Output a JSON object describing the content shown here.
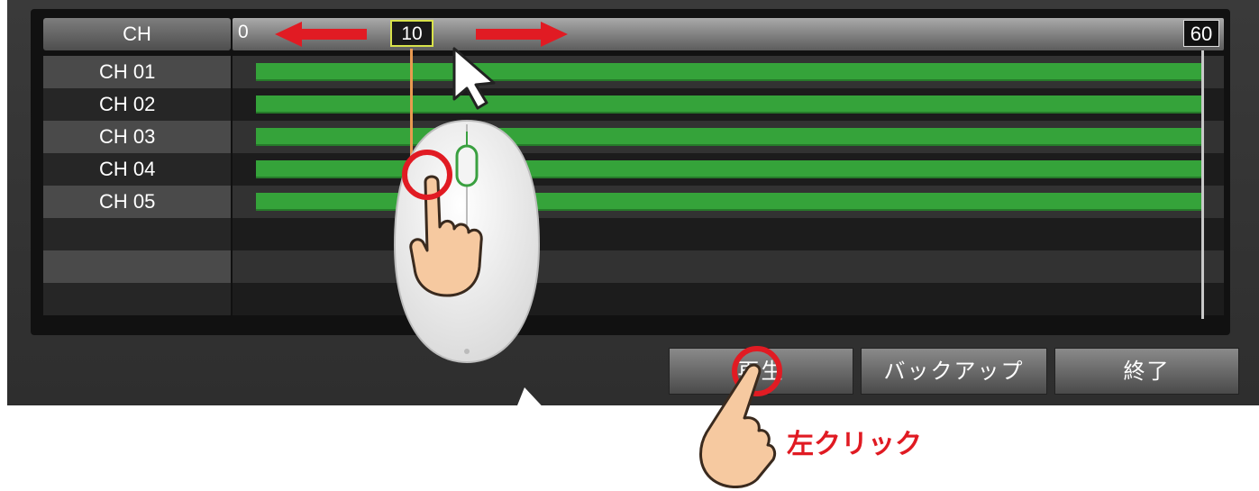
{
  "header": {
    "channel_column_label": "CH",
    "scale_start": "0",
    "scale_cursor": "10",
    "scale_end": "60"
  },
  "channels": [
    {
      "label": "CH 01"
    },
    {
      "label": "CH 02"
    },
    {
      "label": "CH 03"
    },
    {
      "label": "CH 04"
    },
    {
      "label": "CH 05"
    },
    {
      "label": ""
    },
    {
      "label": ""
    },
    {
      "label": ""
    }
  ],
  "buttons": {
    "play": "再生",
    "backup": "バックアップ",
    "exit": "終了"
  },
  "annotation": {
    "instruction": "左クリック"
  },
  "colors": {
    "recording_bar": "#35a33a",
    "cursor_box": "#d8e24a",
    "playhead": "#e89a50",
    "callout_red": "#e11b23"
  },
  "icons": [
    "mouse-pointer-icon",
    "mouse-icon",
    "pointing-hand-icon",
    "arrow-left-icon",
    "arrow-right-icon"
  ]
}
